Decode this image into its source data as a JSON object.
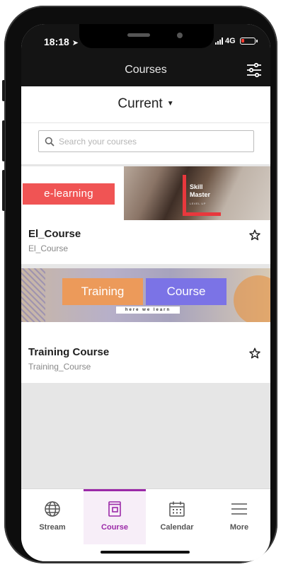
{
  "status": {
    "time": "18:18",
    "network": "4G"
  },
  "header": {
    "title": "Courses"
  },
  "selector": {
    "label": "Current"
  },
  "search": {
    "placeholder": "Search your courses"
  },
  "courses": [
    {
      "title": "El_Course",
      "subtitle": "El_Course",
      "banner": {
        "tag": "e-learning",
        "brand_line1": "Skill",
        "brand_line2": "Master",
        "brand_sub": "LEVEL UP"
      }
    },
    {
      "title": "Training Course",
      "subtitle": "Training_Course",
      "banner": {
        "tag_left": "Training",
        "tag_right": "Course",
        "tagline": "here we learn"
      }
    }
  ],
  "nav": {
    "items": [
      {
        "label": "Stream",
        "icon": "globe-icon"
      },
      {
        "label": "Course",
        "icon": "course-book-icon"
      },
      {
        "label": "Calendar",
        "icon": "calendar-icon"
      },
      {
        "label": "More",
        "icon": "menu-icon"
      }
    ],
    "active": "Course"
  },
  "colors": {
    "accent": "#9b2aa8",
    "elearning_tag": "#f05454",
    "training_tag": "#ec9a5a",
    "course_tag": "#7b73e6",
    "header_bg": "#141414"
  }
}
